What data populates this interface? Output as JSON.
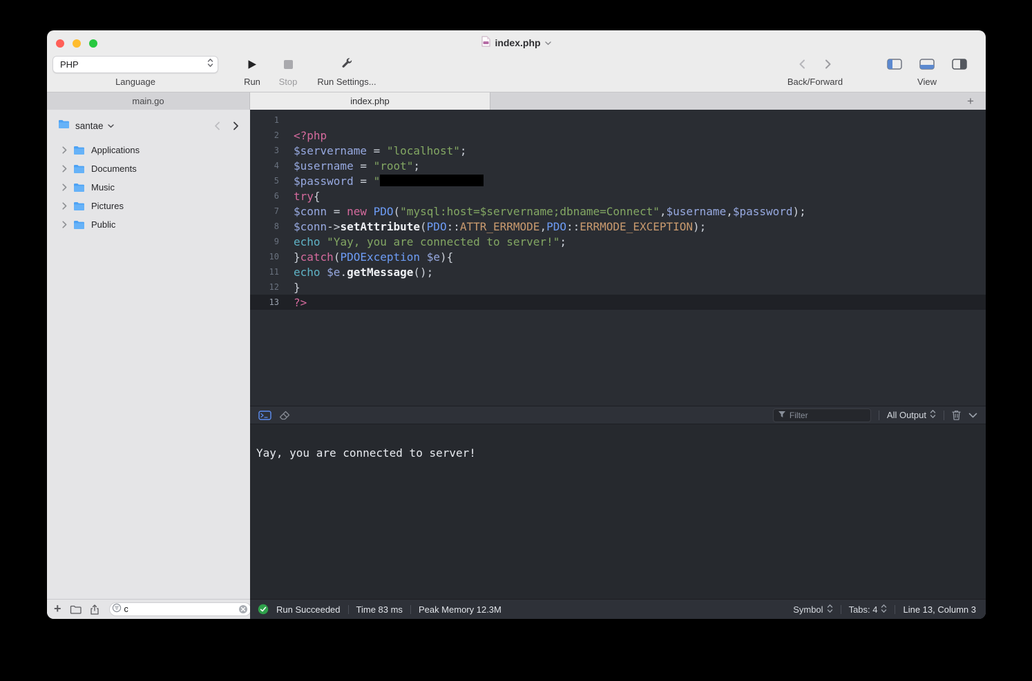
{
  "window": {
    "title": "index.php"
  },
  "toolbar": {
    "language_value": "PHP",
    "language_label": "Language",
    "run_label": "Run",
    "stop_label": "Stop",
    "run_settings_label": "Run Settings...",
    "back_forward_label": "Back/Forward",
    "view_label": "View"
  },
  "tabs": [
    {
      "label": "main.go"
    },
    {
      "label": "index.php"
    }
  ],
  "sidebar": {
    "root_label": "santae",
    "items": [
      {
        "label": "Applications",
        "icon": "folder-icon"
      },
      {
        "label": "Documents",
        "icon": "folder-icon"
      },
      {
        "label": "Music",
        "icon": "folder-icon"
      },
      {
        "label": "Pictures",
        "icon": "folder-icon"
      },
      {
        "label": "Public",
        "icon": "folder-icon"
      }
    ],
    "search_value": "c"
  },
  "editor": {
    "active_line": 13,
    "lines": [
      {
        "n": 1,
        "tokens": []
      },
      {
        "n": 2,
        "tokens": [
          [
            "tag",
            "<?php"
          ]
        ]
      },
      {
        "n": 3,
        "tokens": [
          [
            "var",
            "$servername"
          ],
          [
            "plain",
            " = "
          ],
          [
            "str",
            "\"localhost\""
          ],
          [
            "plain",
            ";"
          ]
        ]
      },
      {
        "n": 4,
        "tokens": [
          [
            "var",
            "$username"
          ],
          [
            "plain",
            " = "
          ],
          [
            "str",
            "\"root\""
          ],
          [
            "plain",
            ";"
          ]
        ]
      },
      {
        "n": 5,
        "tokens": [
          [
            "var",
            "$password"
          ],
          [
            "plain",
            " = "
          ],
          [
            "str",
            "\""
          ],
          [
            "redact",
            ""
          ]
        ]
      },
      {
        "n": 6,
        "tokens": [
          [
            "kw",
            "try"
          ],
          [
            "plain",
            "{"
          ]
        ]
      },
      {
        "n": 7,
        "tokens": [
          [
            "var",
            "$conn"
          ],
          [
            "plain",
            " = "
          ],
          [
            "kw",
            "new"
          ],
          [
            "plain",
            " "
          ],
          [
            "cls",
            "PDO"
          ],
          [
            "plain",
            "("
          ],
          [
            "str",
            "\"mysql:host=$servername;dbname=Connect\""
          ],
          [
            "plain",
            ","
          ],
          [
            "var",
            "$username"
          ],
          [
            "plain",
            ","
          ],
          [
            "var",
            "$password"
          ],
          [
            "plain",
            ");"
          ]
        ]
      },
      {
        "n": 8,
        "tokens": [
          [
            "var",
            "$conn"
          ],
          [
            "plain",
            "->"
          ],
          [
            "fn",
            "setAttribute"
          ],
          [
            "plain",
            "("
          ],
          [
            "cls",
            "PDO"
          ],
          [
            "plain",
            "::"
          ],
          [
            "const",
            "ATTR_ERRMODE"
          ],
          [
            "plain",
            ","
          ],
          [
            "cls",
            "PDO"
          ],
          [
            "plain",
            "::"
          ],
          [
            "const",
            "ERRMODE_EXCEPTION"
          ],
          [
            "plain",
            ");"
          ]
        ]
      },
      {
        "n": 9,
        "tokens": [
          [
            "builtin",
            "echo"
          ],
          [
            "plain",
            " "
          ],
          [
            "str",
            "\"Yay, you are connected to server!\""
          ],
          [
            "plain",
            ";"
          ]
        ]
      },
      {
        "n": 10,
        "tokens": [
          [
            "plain",
            "}"
          ],
          [
            "kw",
            "catch"
          ],
          [
            "plain",
            "("
          ],
          [
            "cls",
            "PDOException"
          ],
          [
            "plain",
            " "
          ],
          [
            "var",
            "$e"
          ],
          [
            "plain",
            "){"
          ]
        ]
      },
      {
        "n": 11,
        "tokens": [
          [
            "builtin",
            "echo"
          ],
          [
            "plain",
            " "
          ],
          [
            "var",
            "$e"
          ],
          [
            "plain",
            "."
          ],
          [
            "fn",
            "getMessage"
          ],
          [
            "plain",
            "();"
          ]
        ]
      },
      {
        "n": 12,
        "tokens": [
          [
            "plain",
            "}"
          ]
        ]
      },
      {
        "n": 13,
        "tokens": [
          [
            "tag",
            "?>"
          ]
        ]
      }
    ]
  },
  "console": {
    "filter_placeholder": "Filter",
    "output_mode": "All Output",
    "output": "Yay, you are connected to server!"
  },
  "statusbar": {
    "run_status": "Run Succeeded",
    "time": "Time 83 ms",
    "memory": "Peak Memory 12.3M",
    "symbol_label": "Symbol",
    "tabs_label": "Tabs: 4",
    "cursor_label": "Line 13, Column 3"
  },
  "colors": {
    "success_green": "#2fa14b",
    "folder_blue": "#4da2f4",
    "console_accent": "#5d8ef2",
    "syntax": {
      "tag": "#d56a9d",
      "kw": "#d56a9d",
      "var": "#97a9e0",
      "str": "#83a763",
      "cls": "#6d9cf5",
      "const": "#c99a6e",
      "builtin": "#5fb3c6",
      "fn": "#eef0f4",
      "plain": "#ccd1d9"
    }
  }
}
